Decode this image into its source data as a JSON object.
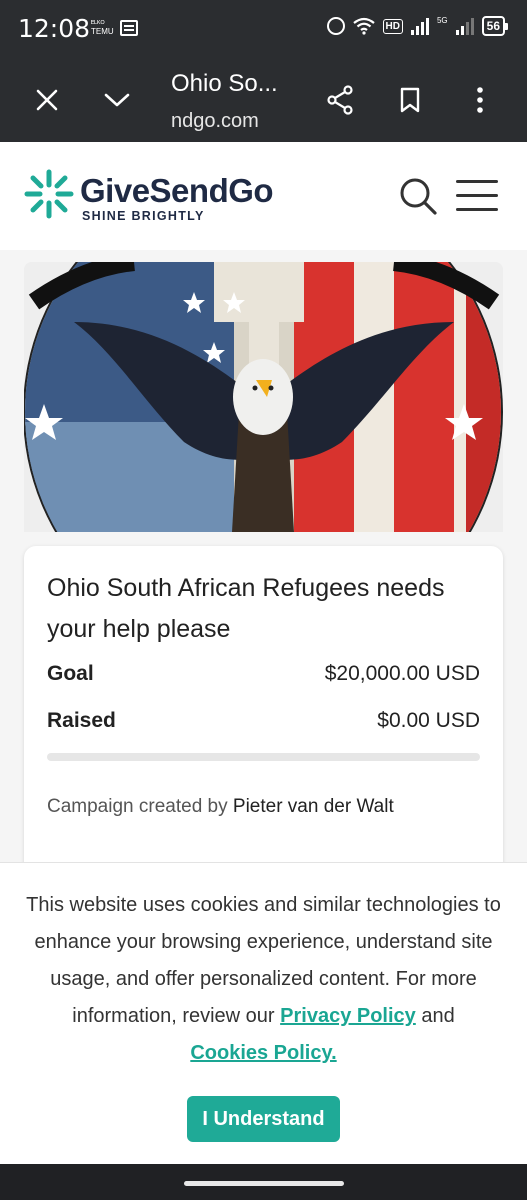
{
  "status_bar": {
    "time": "12:08",
    "temu_label": "ᴱᴸᴷᴼ TEMU",
    "hd": "HD",
    "network": "5G",
    "battery": "56"
  },
  "browser": {
    "title": "Ohio So...",
    "url": "ndgo.com",
    "icons": [
      "close-icon",
      "chevron-down-icon",
      "share-icon",
      "bookmark-icon",
      "more-vert-icon"
    ]
  },
  "site": {
    "logo_text": "GiveSendGo",
    "tagline": "SHINE BRIGHTLY",
    "brand_color": "#1faa97"
  },
  "campaign": {
    "title": "Ohio South African Refugees needs your help please",
    "goal_label": "Goal",
    "goal_value": "$20,000.00 USD",
    "raised_label": "Raised",
    "raised_value": "$0.00 USD",
    "progress_fraction": 0,
    "creator_prefix": "Campaign created by",
    "creator_name": "Pieter van der Walt"
  },
  "cookie_banner": {
    "text": "This website uses cookies and similar technologies to enhance your browsing experience, understand site usage, and offer personalized content. For more information, review our",
    "privacy_link": "Privacy Policy",
    "and": "and",
    "cookies_link": "Cookies Policy.",
    "button": "I Understand"
  }
}
